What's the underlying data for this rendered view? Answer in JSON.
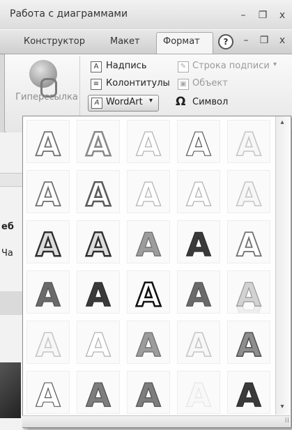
{
  "context_title": "Работа с диаграммами",
  "window_controls": {
    "minimize": "–",
    "restore": "❐",
    "close": "x"
  },
  "tabs": [
    {
      "label": "Конструктор"
    },
    {
      "label": "Макет"
    },
    {
      "label": "Формат"
    }
  ],
  "ribbon_controls": {
    "help": "?",
    "minimize": "–",
    "restore": "❐",
    "close": "x"
  },
  "ribbon": {
    "hyperlink": {
      "label": "Гиперссылка",
      "icon": "globe-chain-icon"
    },
    "items": [
      {
        "label": "Надпись",
        "icon": "textbox-icon",
        "enabled": true
      },
      {
        "label": "Строка подписи",
        "icon": "signature-icon",
        "enabled": false,
        "dropdown": "▾"
      },
      {
        "label": "Колонтитулы",
        "icon": "header-footer-icon",
        "enabled": true
      },
      {
        "label": "Объект",
        "icon": "object-icon",
        "enabled": false
      },
      {
        "label": "WordArt",
        "icon": "wordart-icon",
        "enabled": true,
        "dropdown": "▾"
      },
      {
        "label": "Символ",
        "icon": "omega-icon",
        "glyph": "Ω",
        "enabled": true
      }
    ]
  },
  "document_fragments": [
    "еб",
    "Ча"
  ],
  "gallery": {
    "glyph": "A",
    "styles": [
      [
        "outline-gray",
        "outline-gradient",
        "outline-light",
        "outline-thin",
        "outline-faint"
      ],
      [
        "outline-gray",
        "outline-bold",
        "outline-light",
        "outline-light",
        "outline-faint"
      ],
      [
        "bevel-dark",
        "bevel-dark",
        "gradient-gray",
        "solid-dark",
        "outline-gray"
      ],
      [
        "solid-gray",
        "solid-dark",
        "outline-black",
        "solid-gray",
        "reflection"
      ],
      [
        "outline-faint",
        "outline-light",
        "gradient-gray",
        "outline-faint",
        "shadow-dark"
      ],
      [
        "outline-thin",
        "gradient-dark",
        "gradient-dark",
        "ghost",
        "solid-dark"
      ]
    ]
  },
  "scrollbar": {
    "up_arrow": "▴",
    "down_arrow": "▾",
    "grip": "⁞⁞"
  }
}
